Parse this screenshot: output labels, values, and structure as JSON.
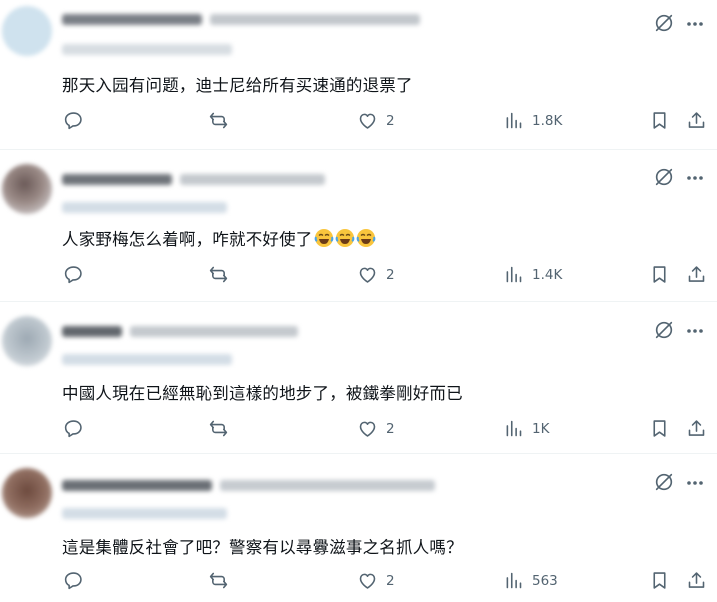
{
  "replies": [
    {
      "text": "那天入园有问题，迪士尼给所有买速通的退票了",
      "likes": "2",
      "views": "1.8K",
      "emoji_count": 0
    },
    {
      "text": "人家野梅怎么着啊，咋就不好使了",
      "likes": "2",
      "views": "1.4K",
      "emoji_count": 3
    },
    {
      "text": "中國人現在已經無恥到這樣的地步了，被鐵拳剛好而已",
      "likes": "2",
      "views": "1K",
      "emoji_count": 0
    },
    {
      "text": "這是集體反社會了吧？警察有以尋釁滋事之名抓人嗎？",
      "likes": "2",
      "views": "563",
      "emoji_count": 0
    }
  ],
  "icons": {
    "reply": "speech-bubble-icon",
    "retweet": "retweet-icon",
    "like": "heart-icon",
    "views": "bar-chart-icon",
    "bookmark": "bookmark-icon",
    "share": "share-upload-icon",
    "grok": "grok-slash-icon",
    "more": "more-dots-icon"
  },
  "colors": {
    "text": "#0f1419",
    "muted": "#536471",
    "divider": "#eff3f4",
    "emoji_face": "#f9c53d"
  }
}
